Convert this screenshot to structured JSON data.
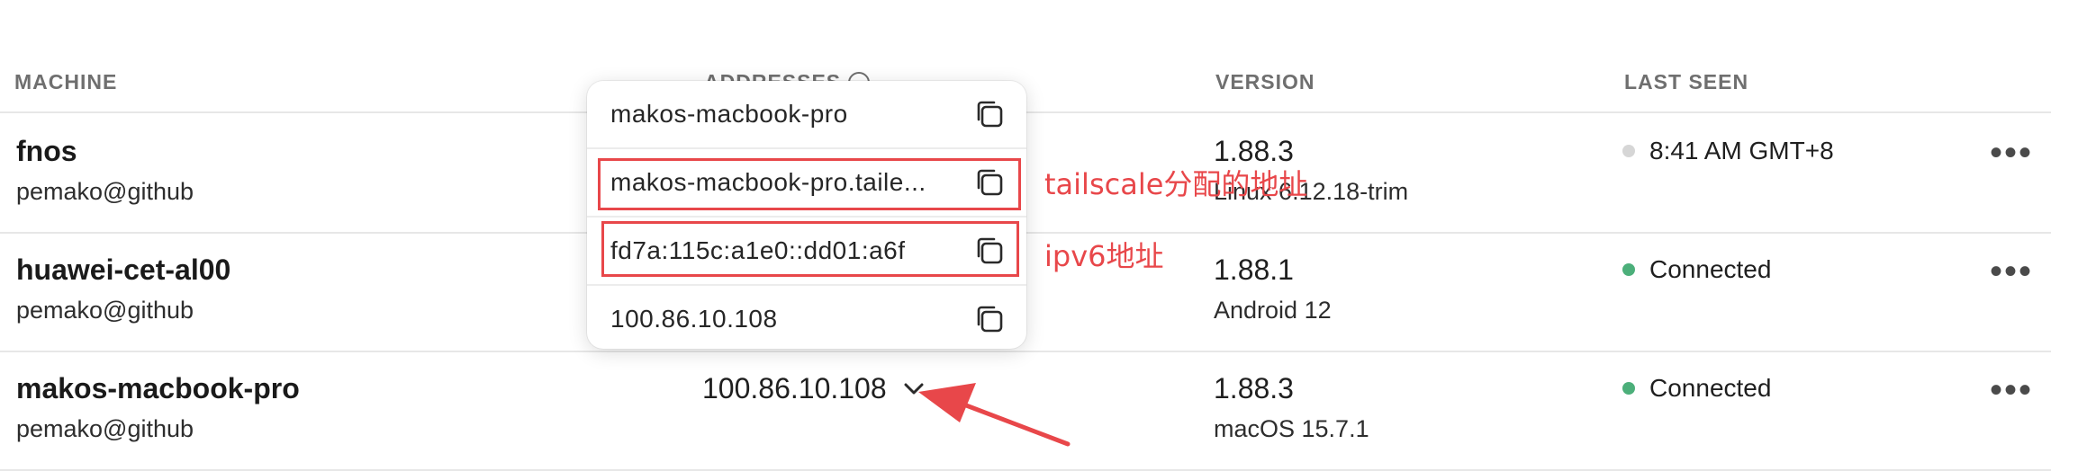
{
  "table": {
    "headers": {
      "machine": "MACHINE",
      "addresses": "ADDRESSES",
      "version": "VERSION",
      "last_seen": "LAST SEEN"
    },
    "rows": [
      {
        "name": "fnos",
        "owner": "pemako@github",
        "version": "1.88.3",
        "os": "Linux 6.12.18-trim",
        "status": "8:41 AM GMT+8",
        "status_color": "#d6d6d6"
      },
      {
        "name": "huawei-cet-al00",
        "owner": "pemako@github",
        "version": "1.88.1",
        "os": "Android 12",
        "status": "Connected",
        "status_color": "#4caf7a"
      },
      {
        "name": "makos-macbook-pro",
        "owner": "pemako@github",
        "address": "100.86.10.108",
        "version": "1.88.3",
        "os": "macOS 15.7.1",
        "status": "Connected",
        "status_color": "#4caf7a"
      }
    ],
    "more_label": "•••"
  },
  "popup": {
    "items": [
      {
        "label": "makos-macbook-pro"
      },
      {
        "label": "makos-macbook-pro.taile..."
      },
      {
        "label": "fd7a:115c:a1e0::dd01:a6f"
      },
      {
        "label": "100.86.10.108"
      }
    ]
  },
  "annotations": {
    "tailscale": "tailscale分配的地址",
    "ipv6": "ipv6地址",
    "color": "#e8474a"
  },
  "icons": [
    "info-icon",
    "copy-icon",
    "chevron-down-icon",
    "more-icon",
    "arrow-annotation"
  ]
}
